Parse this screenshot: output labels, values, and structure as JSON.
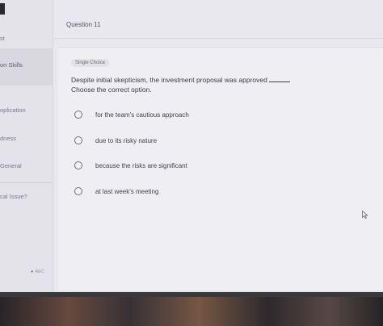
{
  "sidebar": {
    "items": [
      {
        "label": "st"
      },
      {
        "label": "on Skills"
      },
      {
        "label": "oplication"
      },
      {
        "label": "dness"
      },
      {
        "label": "General"
      },
      {
        "label": "cal Issue?"
      }
    ],
    "footer_label": "REC"
  },
  "question": {
    "title": "Question 11",
    "type_badge": "Single Choice",
    "prompt": "Despite initial skepticism, the investment proposal was approved",
    "instruction": "Choose the correct option.",
    "options": [
      {
        "label": "for the team's cautious approach"
      },
      {
        "label": "due to its risky nature"
      },
      {
        "label": "because the risks are significant"
      },
      {
        "label": "at last week's meeting"
      }
    ]
  },
  "colors": {
    "screen_bg": "#e9e8ee",
    "text_primary": "#3c3c44",
    "radio_border": "#6e6e78"
  }
}
